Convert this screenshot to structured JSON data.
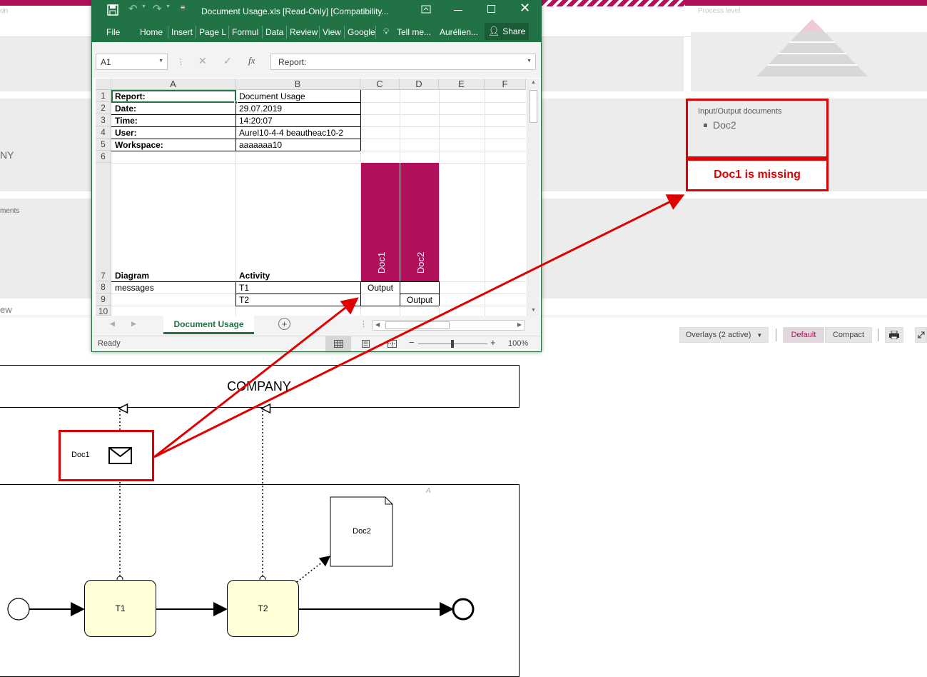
{
  "app": {
    "process_level_label": "Process level",
    "left_fragments": [
      "on",
      "NY",
      "ments",
      "ew"
    ],
    "io_docs_title": "Input/Output documents",
    "io_docs_items": [
      "Doc2"
    ],
    "missing_note": "Doc1 is missing",
    "overlays_label": "Overlays (2 active)",
    "view_default": "Default",
    "view_compact": "Compact"
  },
  "excel": {
    "title": "Document Usage.xls  [Read-Only]  [Compatibility...",
    "menu": [
      "File",
      "Home",
      "Insert",
      "Page L",
      "Formul",
      "Data",
      "Review",
      "View",
      "Google"
    ],
    "tell_me": "Tell me...",
    "user": "Aurélien...",
    "share": "Share",
    "name_box": "A1",
    "formula": "Report:",
    "columns": [
      "A",
      "B",
      "C",
      "D",
      "E",
      "F"
    ],
    "rows": [
      "1",
      "2",
      "3",
      "4",
      "5",
      "6",
      "7",
      "8",
      "9",
      "10"
    ],
    "cells": {
      "a1": "Report:",
      "b1": "Document Usage",
      "a2": "Date:",
      "b2": "29.07.2019",
      "a3": "Time:",
      "b3": "14:20:07",
      "a4": "User:",
      "b4": "Aurel10-4-4 beautheac10-2",
      "a5": "Workspace:",
      "b5": "aaaaaaa10",
      "a7": "Diagram",
      "b7": "Activity",
      "c7": "Doc1",
      "d7": "Doc2",
      "a8": "messages",
      "b8": "T1",
      "c8": "Output",
      "b9": "T2",
      "d9": "Output"
    },
    "sheet_tab": "Document Usage",
    "status": "Ready",
    "zoom": "100%"
  },
  "diagram": {
    "pool_label": "COMPANY",
    "lane_label": "A",
    "message_label": "Doc1",
    "doc_label": "Doc2",
    "task1": "T1",
    "task2": "T2"
  },
  "colors": {
    "accent": "#b0105a",
    "excel_green": "#217346",
    "annotation_red": "#e00000",
    "task_fill": "#ffffd8"
  }
}
